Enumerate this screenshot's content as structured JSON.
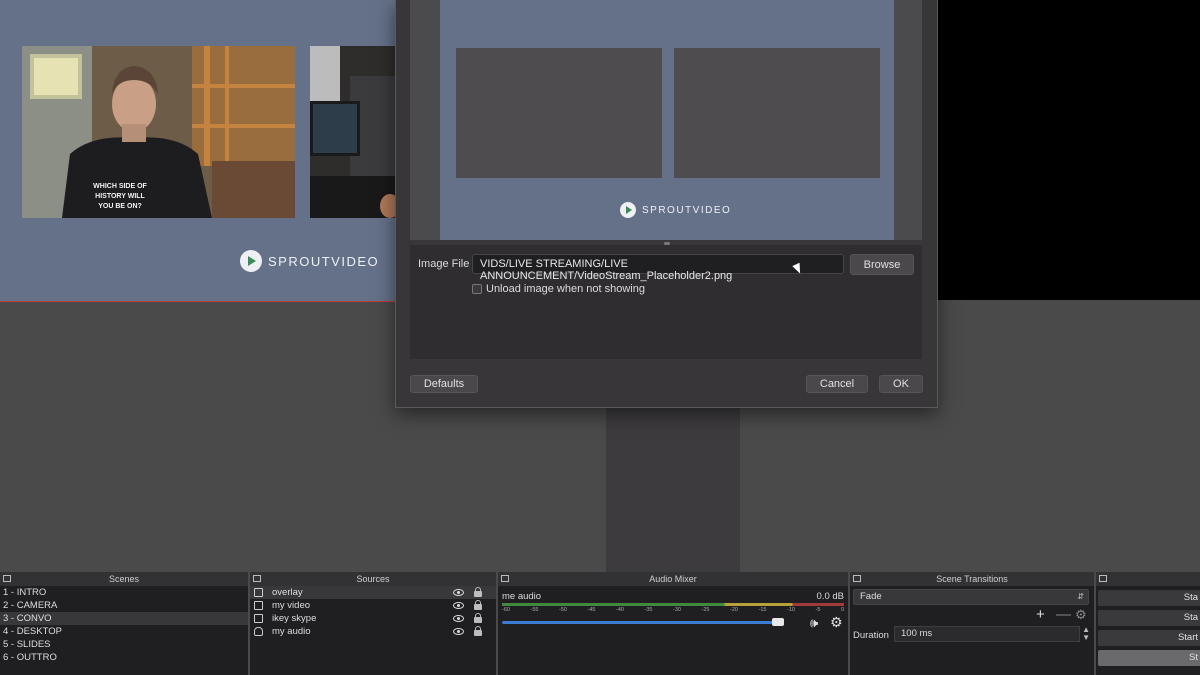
{
  "preview": {
    "brand_text": "SPROUTVIDEO",
    "shirt_text": "WHICH SIDE OF HISTORY WILL YOU BE ON?"
  },
  "dialog": {
    "image_file_label": "Image File",
    "image_file_value": "VIDS/LIVE STREAMING/LIVE ANNOUNCEMENT/VideoStream_Placeholder2.png",
    "browse_label": "Browse",
    "unload_label": "Unload image when not showing",
    "defaults_label": "Defaults",
    "cancel_label": "Cancel",
    "ok_label": "OK",
    "placeholder_brand": "SPROUTVIDEO"
  },
  "scenes": {
    "title": "Scenes",
    "items": [
      "1 - INTRO",
      "2 - CAMERA",
      "3 - CONVO",
      "4 - DESKTOP",
      "5 - SLIDES",
      "6 - OUTTRO"
    ],
    "selected_index": 2
  },
  "sources": {
    "title": "Sources",
    "items": [
      {
        "label": "overlay",
        "icon": "image-icon"
      },
      {
        "label": "my video",
        "icon": "camera-icon"
      },
      {
        "label": "ikey skype",
        "icon": "file-icon"
      },
      {
        "label": "my audio",
        "icon": "microphone-icon"
      }
    ]
  },
  "mixer": {
    "title": "Audio Mixer",
    "channel_name": "me audio",
    "level": "0.0 dB",
    "ticks": [
      "-60",
      "-55",
      "-50",
      "-45",
      "-40",
      "-35",
      "-30",
      "-25",
      "-20",
      "-15",
      "-10",
      "-5",
      "0"
    ],
    "volume_fraction": 0.92
  },
  "transitions": {
    "title": "Scene Transitions",
    "selected": "Fade",
    "duration_label": "Duration",
    "duration_value": "100 ms"
  },
  "controls": {
    "buttons": [
      "Sta",
      "Sta",
      "Start",
      "St"
    ]
  },
  "colors": {
    "canvas_bg": "#657189",
    "accent_blue": "#3a7bd5",
    "selection_border": "#c23a3a"
  }
}
